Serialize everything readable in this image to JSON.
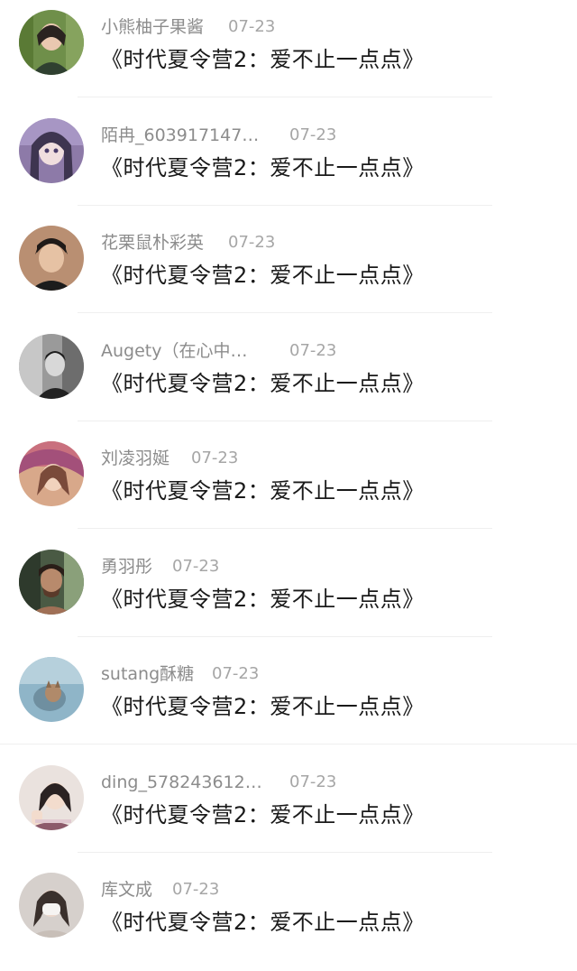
{
  "comments": [
    {
      "username": "小熊柚子果酱",
      "date": "07-23",
      "text": "《时代夏令营2：爱不止一点点》"
    },
    {
      "username": "陌冉_603917147…",
      "date": "07-23",
      "text": "《时代夏令营2：爱不止一点点》"
    },
    {
      "username": "花栗鼠朴彩英",
      "date": "07-23",
      "text": "《时代夏令营2：爱不止一点点》"
    },
    {
      "username": "Augety（在心中…",
      "date": "07-23",
      "text": "《时代夏令营2：爱不止一点点》"
    },
    {
      "username": "刘凌羽娫",
      "date": "07-23",
      "text": "《时代夏令营2：爱不止一点点》"
    },
    {
      "username": "勇羽彤",
      "date": "07-23",
      "text": "《时代夏令营2：爱不止一点点》"
    },
    {
      "username": "sutang酥糖",
      "date": "07-23",
      "text": "《时代夏令营2：爱不止一点点》"
    },
    {
      "username": "ding_578243612…",
      "date": "07-23",
      "text": "《时代夏令营2：爱不止一点点》"
    },
    {
      "username": "库文成",
      "date": "07-23",
      "text": "《时代夏令营2：爱不止一点点》"
    }
  ]
}
